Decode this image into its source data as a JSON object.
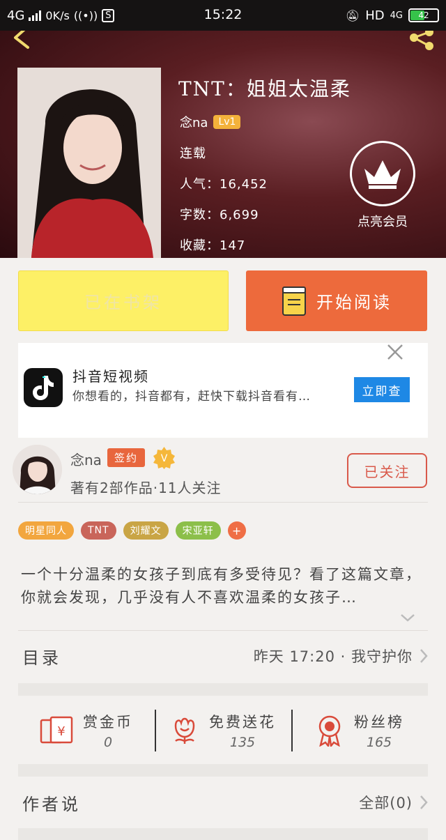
{
  "status_bar": {
    "network": "4G",
    "speed": "0K/s",
    "time": "15:22",
    "hd": "HD",
    "network_right": "4G",
    "battery": "42"
  },
  "book": {
    "title": "TNT：姐姐太温柔",
    "author": "念na",
    "level": "Lv1",
    "status": "连载",
    "popularity": "人气：16,452",
    "word_count": "字数：6,699",
    "favorites": "收藏：147",
    "vip_label": "点亮会员"
  },
  "actions": {
    "shelf_label": "已在书架",
    "read_label": "开始阅读"
  },
  "ad": {
    "title": "抖音短视频",
    "description": "你想看的，抖音都有，赶快下载抖音看有…",
    "cta": "立即查"
  },
  "author_card": {
    "name": "念na",
    "signed_badge": "签约",
    "v_badge": "V",
    "stats": "著有2部作品·11人关注",
    "follow_label": "已关注"
  },
  "tags": [
    {
      "label": "明星同人",
      "color": "#f2a63e"
    },
    {
      "label": "TNT",
      "color": "#c9655a"
    },
    {
      "label": "刘耀文",
      "color": "#c9a545"
    },
    {
      "label": "宋亚轩",
      "color": "#8cbf4a"
    }
  ],
  "tag_add": "+",
  "synopsis": "一个十分温柔的女孩子到底有多受待见？看了这篇文章，你就会发现，几乎没有人不喜欢温柔的女孩子…",
  "toc": {
    "label": "目录",
    "latest": "昨天 17:20 · 我守护你"
  },
  "stats": [
    {
      "label": "赏金币",
      "value": "0",
      "icon": "red-envelope-icon"
    },
    {
      "label": "免费送花",
      "value": "135",
      "icon": "flower-icon"
    },
    {
      "label": "粉丝榜",
      "value": "165",
      "icon": "medal-icon"
    }
  ],
  "author_says": {
    "label": "作者说",
    "all": "全部(0)"
  },
  "colors": {
    "accent": "#ed6a3c",
    "shelf_button": "#fdf066",
    "icon_red": "#d94a3a"
  }
}
